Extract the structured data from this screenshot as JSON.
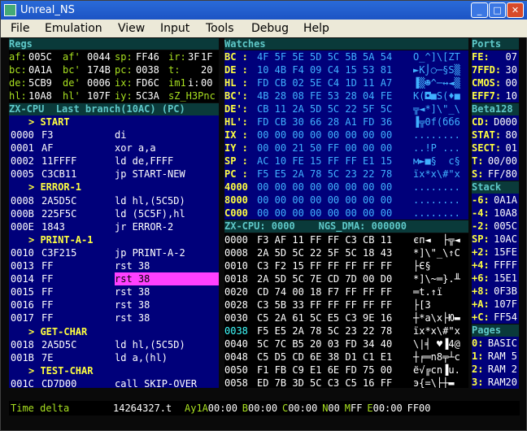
{
  "window": {
    "title": "Unreal_NS"
  },
  "menu": [
    "File",
    "Emulation",
    "View",
    "Input",
    "Tools",
    "Debug",
    "Help"
  ],
  "headers": {
    "regs": "Regs",
    "watches": "Watches",
    "ports": "Ports",
    "beta": "Beta128",
    "stack": "Stack",
    "pages": "Pages"
  },
  "regs": [
    [
      [
        "af:",
        "005C"
      ],
      [
        "af'",
        "0044"
      ],
      [
        "sp:",
        "FF46"
      ],
      [
        "ir:",
        "3F"
      ],
      [
        "",
        "1F"
      ]
    ],
    [
      [
        "bc:",
        "0A1A"
      ],
      [
        "bc'",
        "174B"
      ],
      [
        "pc:",
        "0038"
      ],
      [
        "t:",
        ""
      ],
      [
        "",
        "20"
      ]
    ],
    [
      [
        "de:",
        "5CB9"
      ],
      [
        "de'",
        "0006"
      ],
      [
        "ix:",
        "FD6C"
      ],
      [
        "im1",
        "i:"
      ],
      [
        "",
        "00"
      ]
    ],
    [
      [
        "hl:",
        "10A8"
      ],
      [
        "hl'",
        "107F"
      ],
      [
        "iy:",
        "5C3A"
      ],
      [
        "sZ_H3Pnc",
        ""
      ],
      [
        "",
        ""
      ]
    ]
  ],
  "cpu_bar": "ZX-CPU  Last branch(10AC) (PC)",
  "disasm": [
    {
      "type": "label",
      "text": "> START"
    },
    {
      "addr": "0000",
      "bytes": "F3",
      "asm": "di"
    },
    {
      "addr": "0001",
      "bytes": "AF",
      "asm": "xor a,a"
    },
    {
      "addr": "0002",
      "bytes": "11FFFF",
      "asm": "ld de,FFFF"
    },
    {
      "addr": "0005",
      "bytes": "C3CB11",
      "asm": "jp START-NEW"
    },
    {
      "type": "label",
      "text": "> ERROR-1"
    },
    {
      "addr": "0008",
      "bytes": "2A5D5C",
      "asm": "ld hl,(5C5D)"
    },
    {
      "addr": "000B",
      "bytes": "225F5C",
      "asm": "ld (5C5F),hl"
    },
    {
      "addr": "000E",
      "bytes": "1843",
      "asm": "jr ERROR-2"
    },
    {
      "type": "label",
      "text": "> PRINT-A-1"
    },
    {
      "addr": "0010",
      "bytes": "C3F215",
      "asm": "jp PRINT-A-2"
    },
    {
      "addr": "0013",
      "bytes": "FF",
      "asm": "rst 38"
    },
    {
      "addr": "0014",
      "bytes": "FF",
      "asm": "rst 38",
      "hl": true
    },
    {
      "addr": "0015",
      "bytes": "FF",
      "asm": "rst 38"
    },
    {
      "addr": "0016",
      "bytes": "FF",
      "asm": "rst 38"
    },
    {
      "addr": "0017",
      "bytes": "FF",
      "asm": "rst 38"
    },
    {
      "type": "label",
      "text": "> GET-CHAR"
    },
    {
      "addr": "0018",
      "bytes": "2A5D5C",
      "asm": "ld hl,(5C5D)"
    },
    {
      "addr": "001B",
      "bytes": "7E",
      "asm": "ld a,(hl)"
    },
    {
      "type": "label",
      "text": "> TEST-CHAR"
    },
    {
      "addr": "001C",
      "bytes": "CD7D00",
      "asm": "call SKIP-OVER"
    }
  ],
  "watches": [
    [
      "BC :",
      "4F 5F 5E 5D 5C 5B 5A 54",
      "O_^]\\[ZT"
    ],
    [
      "DE :",
      "10 4B F4 09 C4 15 53 81",
      "►K⌡○─§S▒"
    ],
    [
      "HL :",
      "FD CB 02 5E C4 1D 11 A7",
      "▐▒☻^─↔◄▒"
    ],
    [
      "BC':",
      "4B 28 08 FE 53 28 04 FE",
      "K(◘■S(♦■"
    ],
    [
      "DE':",
      "CB 11 2A 5D 5C 22 5F 5C",
      "╦◄*]\\\"_\\"
    ],
    [
      "HL':",
      "FD CB 30 66 28 A1 FD 36",
      "▐╦0f(бб6"
    ],
    [
      "IX :",
      "00 00 00 00 00 00 00 00",
      "........"
    ],
    [
      "IY :",
      "00 00 21 50 FF 00 00 00",
      "..!P ..."
    ],
    [
      "SP :",
      "AC 10 FE 15 FF FF E1 15",
      "м►■§  с§"
    ],
    [
      "PC :",
      "F5 E5 2A 78 5C 23 22 78",
      "їх*x\\#\"x"
    ],
    [
      "4000",
      "00 00 00 00 00 00 00 00",
      "........"
    ],
    [
      "8000",
      "00 00 00 00 00 00 00 00",
      "........"
    ],
    [
      "C000",
      "00 00 00 00 00 00 00 00",
      "........"
    ]
  ],
  "cpu_bar2": "ZX-CPU: 0000    NGS_DMA: 000000",
  "memory": [
    [
      "0000",
      "F3 AF 11 FF FF C3 CB 11",
      "єп◄  ├╦◄"
    ],
    [
      "0008",
      "2A 5D 5C 22 5F 5C 18 43",
      "*]\\\"_\\↑C"
    ],
    [
      "0010",
      "C3 F2 15 FF FF FF FF FF",
      "├Є§     "
    ],
    [
      "0018",
      "2A 5D 5C 7E CD 7D 00 D0",
      "*]\\~═}.╨"
    ],
    [
      "0020",
      "CD 74 00 18 F7 FF FF FF",
      "═t.↑ї   "
    ],
    [
      "0028",
      "C3 5B 33 FF FF FF FF FF",
      "├[3     "
    ],
    [
      "0030",
      "C5 2A 61 5C E5 C3 9E 16",
      "┼*a\\х├Ю▬"
    ],
    [
      "0038",
      "F5 E5 2A 78 5C 23 22 78",
      "їх*x\\#\"x"
    ],
    [
      "0040",
      "5C 7C B5 20 03 FD 34 40",
      "\\|╡ ♥▐4@"
    ],
    [
      "0048",
      "C5 D5 CD 6E 38 D1 C1 E1",
      "┼╒═n8╤┴с"
    ],
    [
      "0050",
      "F1 FB C9 E1 6E FD 75 00",
      "ё√╔сn▐u."
    ],
    [
      "0058",
      "ED 7B 3D 5C C3 C5 16 FF",
      "э{=\\├┼▬ "
    ]
  ],
  "ports": [
    [
      "FE:",
      "07"
    ],
    [
      "7FFD:",
      "30"
    ],
    [
      "CMOS:",
      "00"
    ],
    [
      "EFF7:",
      "10"
    ]
  ],
  "beta": [
    [
      "CD:",
      "D000"
    ],
    [
      "STAT:",
      "80"
    ],
    [
      "SECT:",
      "01"
    ],
    [
      "T:",
      "00/00"
    ],
    [
      "S:",
      "FF/80"
    ]
  ],
  "stack": [
    [
      "-6:",
      "0A1A"
    ],
    [
      "-4:",
      "10A8"
    ],
    [
      "-2:",
      "005C"
    ],
    [
      "SP:",
      "10AC"
    ],
    [
      "+2:",
      "15FE"
    ],
    [
      "+4:",
      "FFFF"
    ],
    [
      "+6:",
      "15E1"
    ],
    [
      "+8:",
      "0F3B"
    ],
    [
      "+A:",
      "107F"
    ],
    [
      "+C:",
      "FF54"
    ]
  ],
  "pages": [
    [
      "0:",
      "BASIC"
    ],
    [
      "1:",
      "RAM 5"
    ],
    [
      "2:",
      "RAM 2"
    ],
    [
      "3:",
      "RAM20"
    ]
  ],
  "status": {
    "label": "Time delta",
    "value": "14264327.t",
    "ay": [
      [
        "Ay1A",
        "00:00"
      ],
      [
        "B",
        "00:00"
      ],
      [
        "C",
        "00:00"
      ],
      [
        "N",
        "00"
      ],
      [
        "M",
        "FF"
      ],
      [
        "E",
        "00:00"
      ],
      [
        "",
        "FF00"
      ]
    ]
  }
}
